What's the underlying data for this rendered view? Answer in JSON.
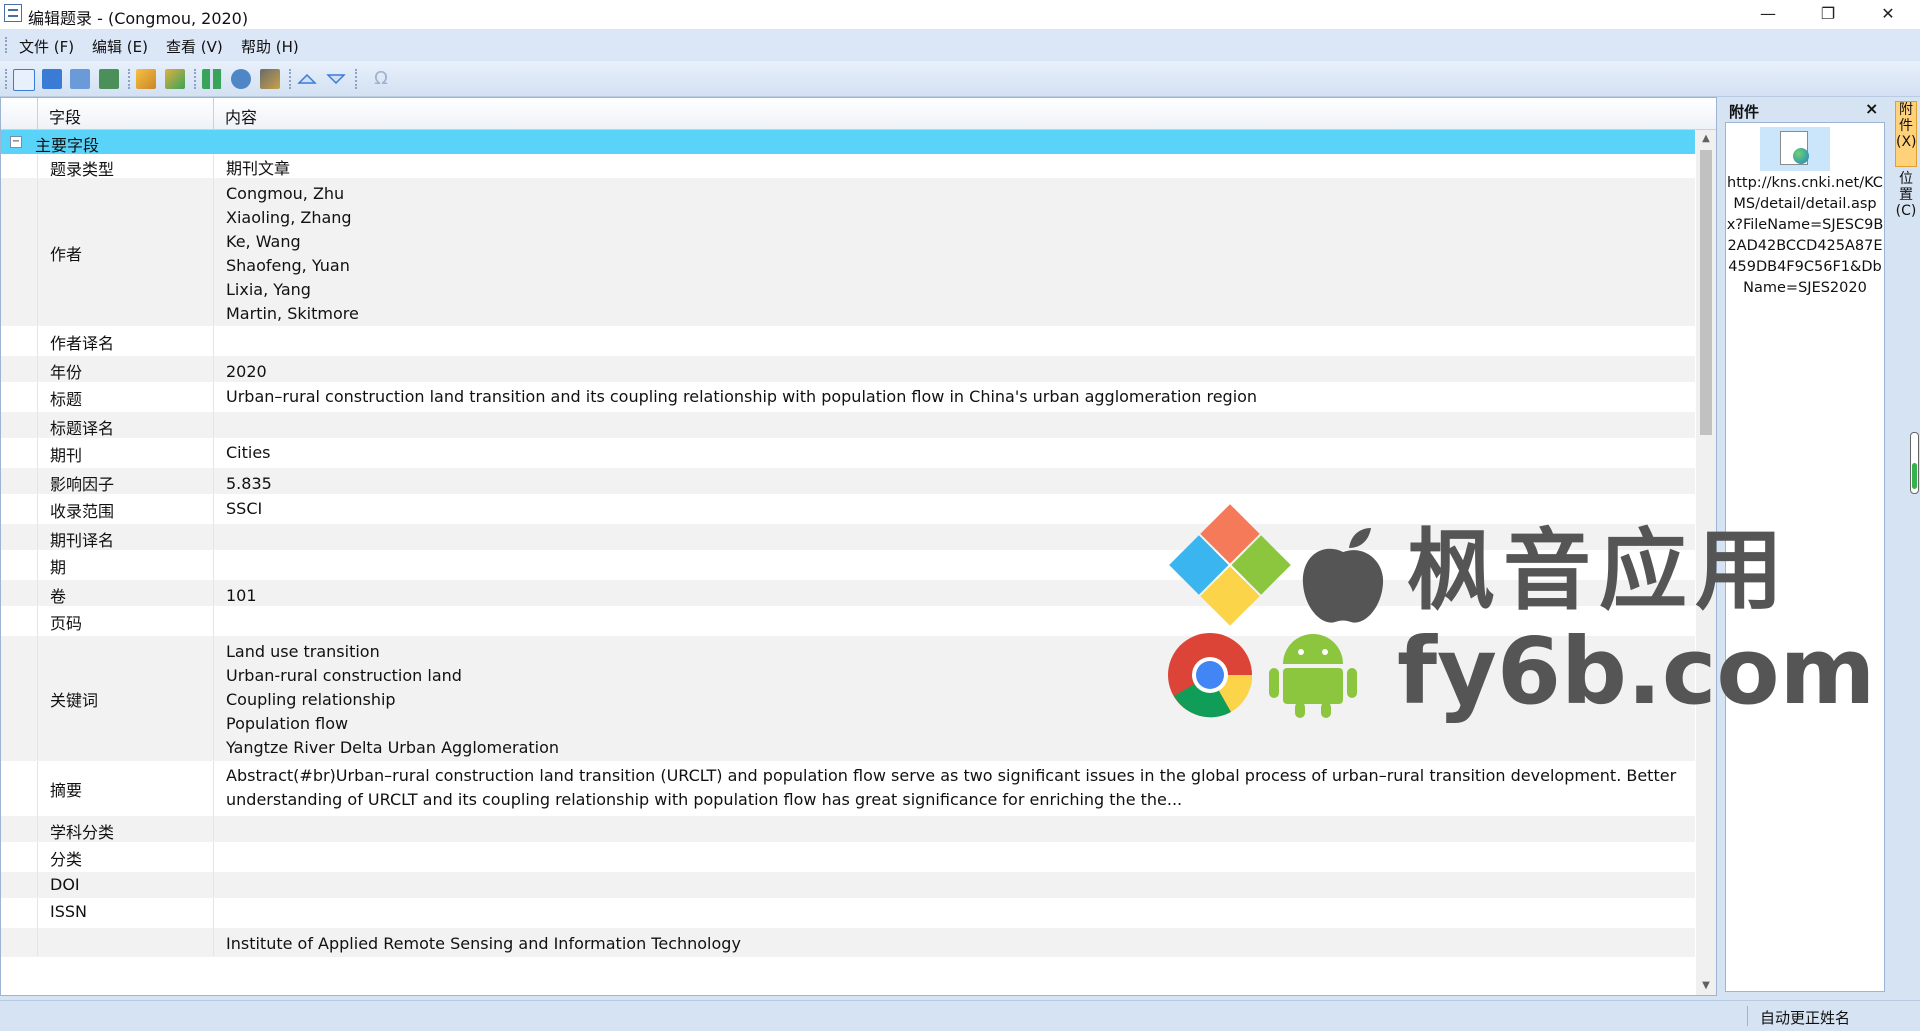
{
  "window": {
    "title": "编辑题录 - (Congmou, 2020)",
    "minimize": "—",
    "restore": "❐",
    "close": "✕"
  },
  "menu": [
    "文件 (F)",
    "编辑 (E)",
    "查看 (V)",
    "帮助 (H)"
  ],
  "toolbar": {
    "icons": [
      "new-doc-icon",
      "save-icon",
      "save-all-icon",
      "export-icon",
      "brush-icon",
      "chart-icon",
      "grid-icon",
      "pin-icon",
      "import-icon",
      "arrow-up-icon",
      "arrow-down-icon",
      "omega-icon"
    ]
  },
  "grid": {
    "col_field": "字段",
    "col_content": "内容",
    "group_label": "主要字段",
    "group_toggle": "−",
    "rows": [
      {
        "field": "题录类型",
        "value": "期刊文章"
      },
      {
        "field": "作者",
        "value": "Congmou, Zhu\nXiaoling, Zhang\nKe, Wang\nShaofeng, Yuan\nLixia, Yang\nMartin, Skitmore"
      },
      {
        "field": "作者译名",
        "value": ""
      },
      {
        "field": "年份",
        "value": "2020"
      },
      {
        "field": "标题",
        "value": "Urban–rural construction land transition and its coupling relationship with population flow in China's urban agglomeration region"
      },
      {
        "field": "标题译名",
        "value": ""
      },
      {
        "field": "期刊",
        "value": "Cities"
      },
      {
        "field": "影响因子",
        "value": "   5.835"
      },
      {
        "field": "收录范围",
        "value": "SSCI"
      },
      {
        "field": "期刊译名",
        "value": ""
      },
      {
        "field": "期",
        "value": ""
      },
      {
        "field": "卷",
        "value": "101"
      },
      {
        "field": "页码",
        "value": ""
      },
      {
        "field": "关键词",
        "value": "Land use transition\nUrban-rural construction land\nCoupling relationship\nPopulation flow\nYangtze River Delta Urban Agglomeration"
      },
      {
        "field": "摘要",
        "value": "Abstract(#br)Urban–rural construction land transition (URCLT) and population flow serve as two significant issues in the global process of urban–rural transition development. Better\nunderstanding of URCLT and its coupling relationship with population flow has great significance for enriching the the..."
      },
      {
        "field": "学科分类",
        "value": ""
      },
      {
        "field": "分类",
        "value": ""
      },
      {
        "field": "DOI",
        "value": ""
      },
      {
        "field": "ISSN",
        "value": ""
      },
      {
        "field": "",
        "value": "Institute of Applied Remote Sensing and Information Technology"
      }
    ]
  },
  "attachments": {
    "title": "附件",
    "close": "×",
    "file_url": "http://kns.cnki.net/KCMS/detail/detail.aspx?FileName=SJESC9B2AD42BCCD425A87E459DB4F9C56F1&DbName=SJES2020"
  },
  "side_tabs": [
    "附件(X)",
    "位置(C)"
  ],
  "status": {
    "text": "自动更正姓名"
  },
  "watermark": {
    "line1": "枫音应用",
    "line2": "fy6b.com"
  }
}
